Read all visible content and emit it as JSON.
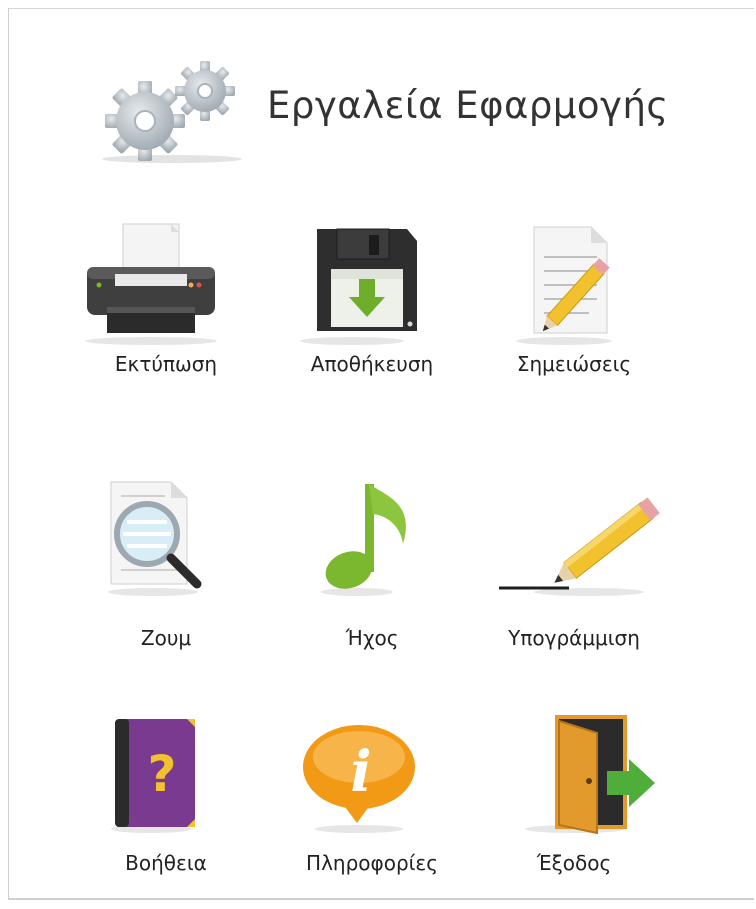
{
  "header": {
    "title": "Εργαλεία Εφαρμογής",
    "icon": "gears-icon"
  },
  "tools": {
    "print": {
      "label": "Εκτύπωση",
      "icon": "printer-icon"
    },
    "save": {
      "label": "Αποθήκευση",
      "icon": "floppy-disk-icon"
    },
    "notes": {
      "label": "Σημειώσεις",
      "icon": "notepad-pencil-icon"
    },
    "zoom": {
      "label": "Ζουμ",
      "icon": "magnifier-document-icon"
    },
    "sound": {
      "label": "Ήχος",
      "icon": "music-note-icon"
    },
    "underline": {
      "label": "Υπογράμμιση",
      "icon": "pencil-underline-icon"
    },
    "help": {
      "label": "Βοήθεια",
      "icon": "help-book-icon"
    },
    "info": {
      "label": "Πληροφορίες",
      "icon": "info-bubble-icon"
    },
    "exit": {
      "label": "Έξοδος",
      "icon": "exit-door-icon"
    }
  },
  "colors": {
    "gear": "#b9c1c7",
    "save_green": "#6fae2a",
    "music_green": "#7cb82f",
    "pencil_yellow": "#f2c12e",
    "help_purple": "#7a3a8f",
    "info_orange": "#f29a16",
    "door_orange": "#e39a2d",
    "exit_arrow": "#4fae3a"
  }
}
